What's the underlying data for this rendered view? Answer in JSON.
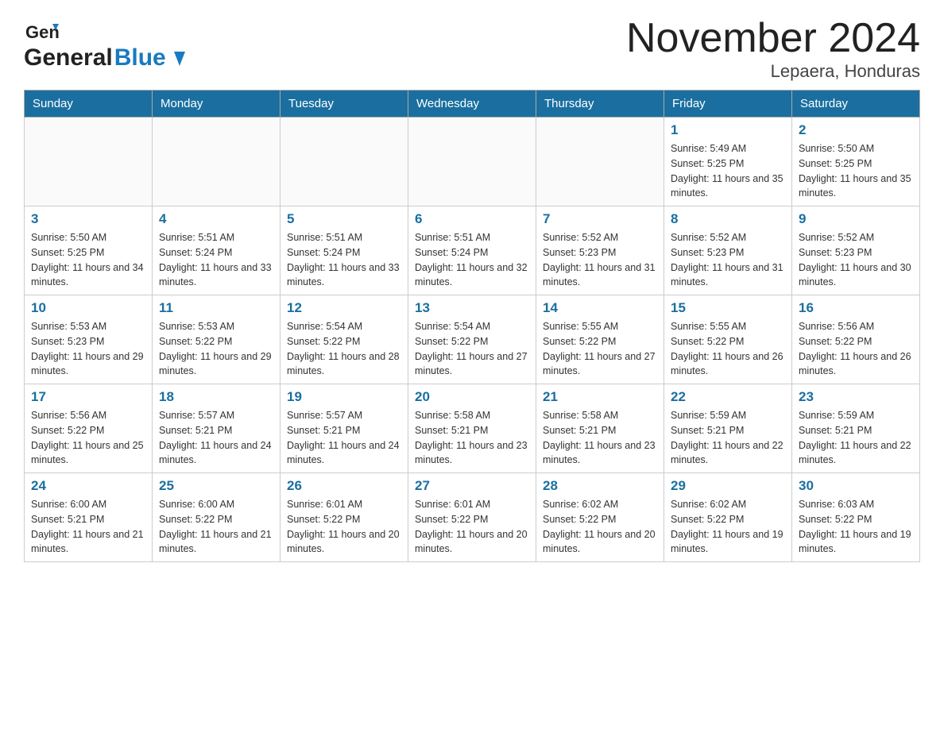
{
  "header": {
    "logo_general": "General",
    "logo_blue": "Blue",
    "title": "November 2024",
    "subtitle": "Lepaera, Honduras"
  },
  "weekdays": [
    "Sunday",
    "Monday",
    "Tuesday",
    "Wednesday",
    "Thursday",
    "Friday",
    "Saturday"
  ],
  "weeks": [
    [
      {
        "day": "",
        "info": ""
      },
      {
        "day": "",
        "info": ""
      },
      {
        "day": "",
        "info": ""
      },
      {
        "day": "",
        "info": ""
      },
      {
        "day": "",
        "info": ""
      },
      {
        "day": "1",
        "info": "Sunrise: 5:49 AM\nSunset: 5:25 PM\nDaylight: 11 hours and 35 minutes."
      },
      {
        "day": "2",
        "info": "Sunrise: 5:50 AM\nSunset: 5:25 PM\nDaylight: 11 hours and 35 minutes."
      }
    ],
    [
      {
        "day": "3",
        "info": "Sunrise: 5:50 AM\nSunset: 5:25 PM\nDaylight: 11 hours and 34 minutes."
      },
      {
        "day": "4",
        "info": "Sunrise: 5:51 AM\nSunset: 5:24 PM\nDaylight: 11 hours and 33 minutes."
      },
      {
        "day": "5",
        "info": "Sunrise: 5:51 AM\nSunset: 5:24 PM\nDaylight: 11 hours and 33 minutes."
      },
      {
        "day": "6",
        "info": "Sunrise: 5:51 AM\nSunset: 5:24 PM\nDaylight: 11 hours and 32 minutes."
      },
      {
        "day": "7",
        "info": "Sunrise: 5:52 AM\nSunset: 5:23 PM\nDaylight: 11 hours and 31 minutes."
      },
      {
        "day": "8",
        "info": "Sunrise: 5:52 AM\nSunset: 5:23 PM\nDaylight: 11 hours and 31 minutes."
      },
      {
        "day": "9",
        "info": "Sunrise: 5:52 AM\nSunset: 5:23 PM\nDaylight: 11 hours and 30 minutes."
      }
    ],
    [
      {
        "day": "10",
        "info": "Sunrise: 5:53 AM\nSunset: 5:23 PM\nDaylight: 11 hours and 29 minutes."
      },
      {
        "day": "11",
        "info": "Sunrise: 5:53 AM\nSunset: 5:22 PM\nDaylight: 11 hours and 29 minutes."
      },
      {
        "day": "12",
        "info": "Sunrise: 5:54 AM\nSunset: 5:22 PM\nDaylight: 11 hours and 28 minutes."
      },
      {
        "day": "13",
        "info": "Sunrise: 5:54 AM\nSunset: 5:22 PM\nDaylight: 11 hours and 27 minutes."
      },
      {
        "day": "14",
        "info": "Sunrise: 5:55 AM\nSunset: 5:22 PM\nDaylight: 11 hours and 27 minutes."
      },
      {
        "day": "15",
        "info": "Sunrise: 5:55 AM\nSunset: 5:22 PM\nDaylight: 11 hours and 26 minutes."
      },
      {
        "day": "16",
        "info": "Sunrise: 5:56 AM\nSunset: 5:22 PM\nDaylight: 11 hours and 26 minutes."
      }
    ],
    [
      {
        "day": "17",
        "info": "Sunrise: 5:56 AM\nSunset: 5:22 PM\nDaylight: 11 hours and 25 minutes."
      },
      {
        "day": "18",
        "info": "Sunrise: 5:57 AM\nSunset: 5:21 PM\nDaylight: 11 hours and 24 minutes."
      },
      {
        "day": "19",
        "info": "Sunrise: 5:57 AM\nSunset: 5:21 PM\nDaylight: 11 hours and 24 minutes."
      },
      {
        "day": "20",
        "info": "Sunrise: 5:58 AM\nSunset: 5:21 PM\nDaylight: 11 hours and 23 minutes."
      },
      {
        "day": "21",
        "info": "Sunrise: 5:58 AM\nSunset: 5:21 PM\nDaylight: 11 hours and 23 minutes."
      },
      {
        "day": "22",
        "info": "Sunrise: 5:59 AM\nSunset: 5:21 PM\nDaylight: 11 hours and 22 minutes."
      },
      {
        "day": "23",
        "info": "Sunrise: 5:59 AM\nSunset: 5:21 PM\nDaylight: 11 hours and 22 minutes."
      }
    ],
    [
      {
        "day": "24",
        "info": "Sunrise: 6:00 AM\nSunset: 5:21 PM\nDaylight: 11 hours and 21 minutes."
      },
      {
        "day": "25",
        "info": "Sunrise: 6:00 AM\nSunset: 5:22 PM\nDaylight: 11 hours and 21 minutes."
      },
      {
        "day": "26",
        "info": "Sunrise: 6:01 AM\nSunset: 5:22 PM\nDaylight: 11 hours and 20 minutes."
      },
      {
        "day": "27",
        "info": "Sunrise: 6:01 AM\nSunset: 5:22 PM\nDaylight: 11 hours and 20 minutes."
      },
      {
        "day": "28",
        "info": "Sunrise: 6:02 AM\nSunset: 5:22 PM\nDaylight: 11 hours and 20 minutes."
      },
      {
        "day": "29",
        "info": "Sunrise: 6:02 AM\nSunset: 5:22 PM\nDaylight: 11 hours and 19 minutes."
      },
      {
        "day": "30",
        "info": "Sunrise: 6:03 AM\nSunset: 5:22 PM\nDaylight: 11 hours and 19 minutes."
      }
    ]
  ]
}
